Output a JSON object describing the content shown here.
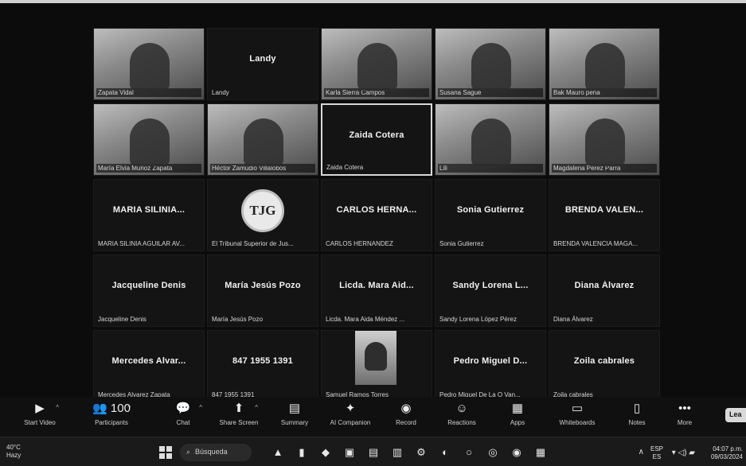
{
  "gallery": {
    "tiles": [
      {
        "display": "",
        "tag": "Zapata Vidal",
        "video": true,
        "active": false
      },
      {
        "display": "Landy",
        "tag": "Landy",
        "video": false,
        "active": false
      },
      {
        "display": "",
        "tag": "Karla Sierra Campos",
        "video": true,
        "active": false
      },
      {
        "display": "",
        "tag": "Susana Sagué",
        "video": true,
        "active": false
      },
      {
        "display": "",
        "tag": "Bak Mauro peña",
        "video": true,
        "active": false
      },
      {
        "display": "",
        "tag": "María Elvia Muñoz Zapata",
        "video": true,
        "active": false
      },
      {
        "display": "",
        "tag": "Héctor Zamudio Villalobos",
        "video": true,
        "active": false
      },
      {
        "display": "Zaida Cotera",
        "tag": "Zaida Cotera",
        "video": false,
        "active": true
      },
      {
        "display": "",
        "tag": "Lili",
        "video": true,
        "active": false
      },
      {
        "display": "",
        "tag": "Magdalena Pérez Parra",
        "video": true,
        "active": false
      },
      {
        "display": "MARIA SILINIA...",
        "tag": "MARIA SILINIA AGUILAR AV...",
        "video": false,
        "active": false
      },
      {
        "display": "",
        "tag": "El Tribunal Superior de Jus...",
        "video": false,
        "active": false,
        "logo": "TJG"
      },
      {
        "display": "CARLOS HERNA...",
        "tag": "CARLOS HERNANDEZ",
        "video": false,
        "active": false
      },
      {
        "display": "Sonia Gutierrez",
        "tag": "Sonia Gutierrez",
        "video": false,
        "active": false
      },
      {
        "display": "BRENDA VALEN...",
        "tag": "BRENDA VALENCIA MAGA...",
        "video": false,
        "active": false
      },
      {
        "display": "Jacqueline Denis",
        "tag": "Jacqueline Denis",
        "video": false,
        "active": false
      },
      {
        "display": "María Jesús Pozo",
        "tag": "María Jesús Pozo",
        "video": false,
        "active": false
      },
      {
        "display": "Licda. Mara Aid...",
        "tag": "Licda. Mara Aida Méndez ...",
        "video": false,
        "active": false
      },
      {
        "display": "Sandy Lorena L...",
        "tag": "Sandy Lorena López Pérez",
        "video": false,
        "active": false
      },
      {
        "display": "Diana Álvarez",
        "tag": "Diana Álvarez",
        "video": false,
        "active": false
      },
      {
        "display": "Mercedes Alvar...",
        "tag": "Mercedes Alvarez Zapata",
        "video": false,
        "active": false
      },
      {
        "display": "847 1955 1391",
        "tag": "847 1955 1391",
        "video": false,
        "active": false
      },
      {
        "display": "",
        "tag": "Samuel Ramos Torres",
        "video": false,
        "active": false,
        "thumb": true
      },
      {
        "display": "Pedro Miguel D...",
        "tag": "Pedro Miguel De La O Van...",
        "video": false,
        "active": false
      },
      {
        "display": "Zoila cabrales",
        "tag": "Zoila cabrales",
        "video": false,
        "active": false
      }
    ]
  },
  "toolbar": {
    "leave": "Lea",
    "buttons": [
      {
        "label": "Start Video",
        "icon": "▶",
        "name": "start-video-button"
      },
      {
        "label": "Participants",
        "icon": "👥 100",
        "name": "participants-button"
      },
      {
        "label": "Chat",
        "icon": "💬",
        "name": "chat-button"
      },
      {
        "label": "Share Screen",
        "icon": "⬆",
        "name": "share-screen-button"
      },
      {
        "label": "Summary",
        "icon": "▤",
        "name": "summary-button"
      },
      {
        "label": "AI Companion",
        "icon": "✦",
        "name": "ai-companion-button"
      },
      {
        "label": "Record",
        "icon": "◉",
        "name": "record-button"
      },
      {
        "label": "Reactions",
        "icon": "☺",
        "name": "reactions-button"
      },
      {
        "label": "Apps",
        "icon": "▦",
        "name": "apps-button"
      },
      {
        "label": "Whiteboards",
        "icon": "▭",
        "name": "whiteboards-button"
      },
      {
        "label": "Notes",
        "icon": "▯",
        "name": "notes-button"
      },
      {
        "label": "More",
        "icon": "•••",
        "name": "more-button"
      }
    ]
  },
  "taskbar": {
    "weather_temp": "40°C",
    "weather_desc": "Hazy",
    "search_placeholder": "Búsqueda",
    "apps": [
      "▲",
      "▮",
      "◆",
      "▣",
      "▤",
      "▥",
      "⚙",
      "◐",
      "○",
      "◎",
      "◉",
      "▦"
    ],
    "lang_top": "ESP",
    "lang_bottom": "ES",
    "clock_time": "04:07 p.m.",
    "clock_date": "09/03/2024"
  }
}
